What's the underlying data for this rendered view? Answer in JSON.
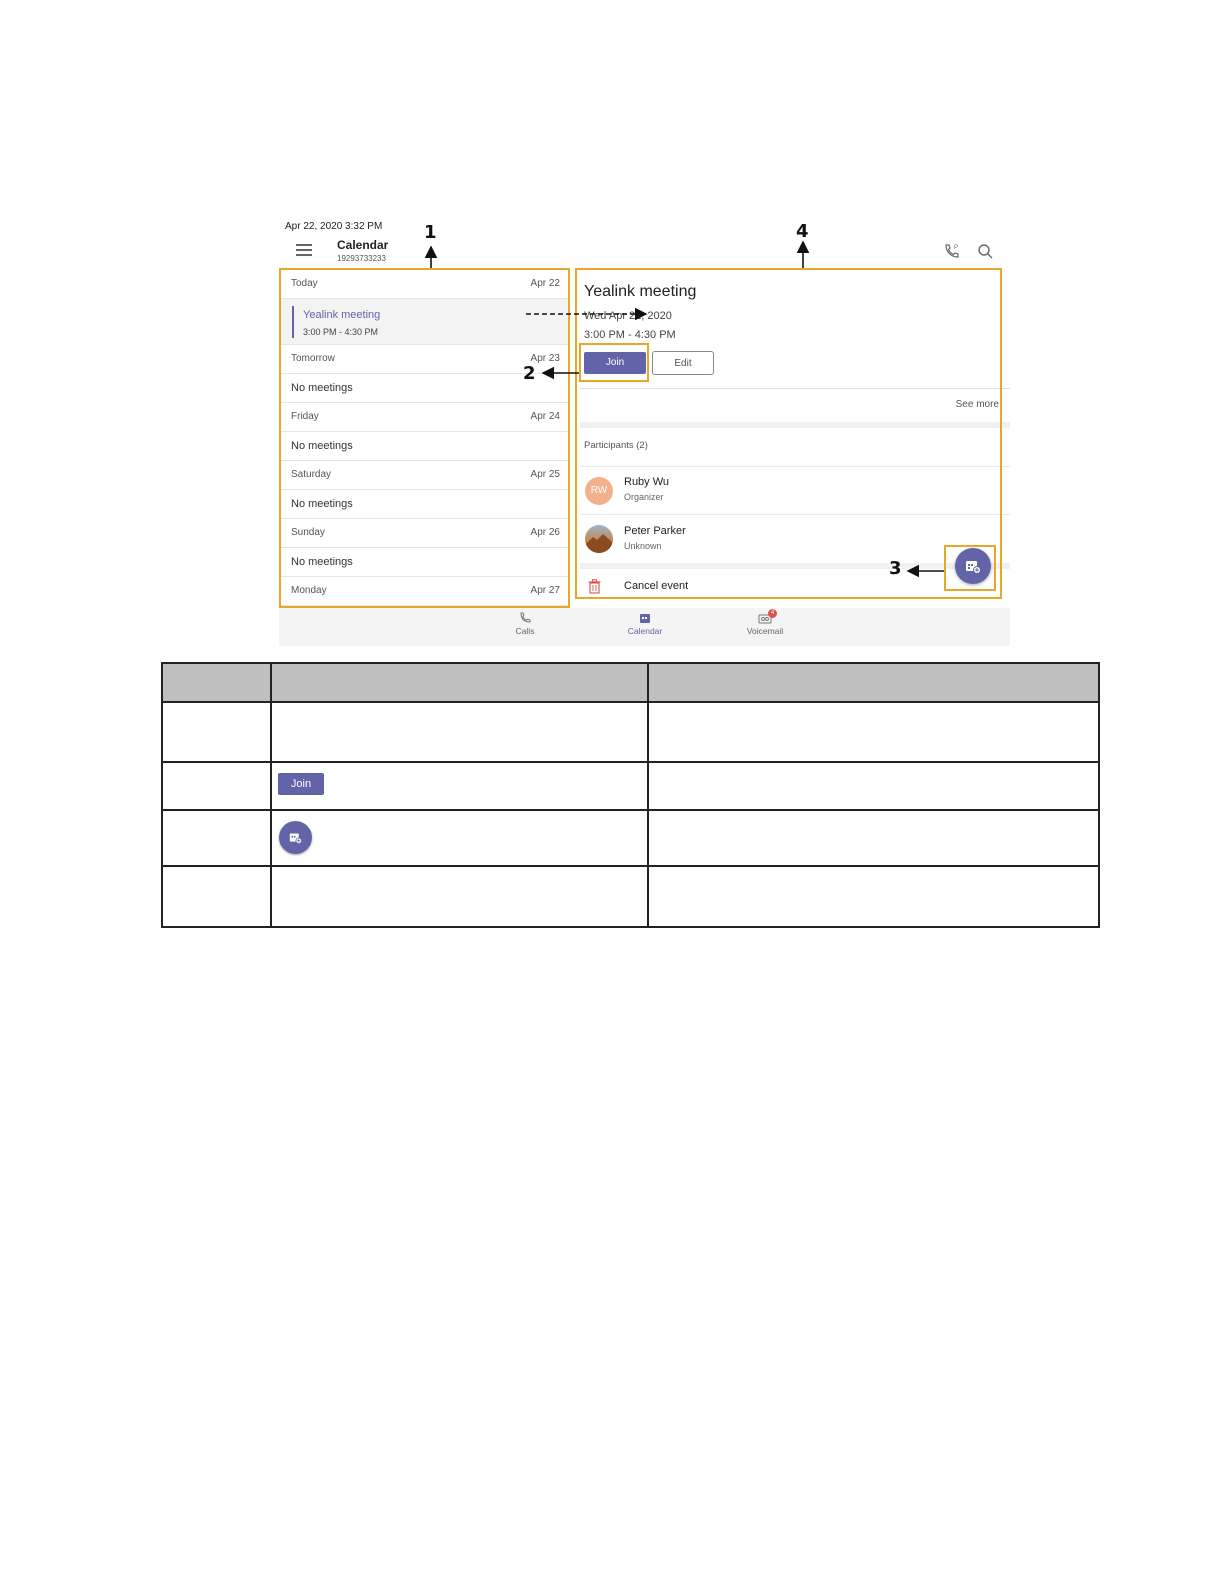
{
  "status_bar": {
    "datetime": "Apr 22, 2020   3:32 PM"
  },
  "header": {
    "title": "Calendar",
    "number": "19293733233"
  },
  "agenda": {
    "days": [
      {
        "name": "Today",
        "date": "Apr 22"
      },
      {
        "name": "Tomorrow",
        "date": "Apr 23"
      },
      {
        "name": "Friday",
        "date": "Apr 24"
      },
      {
        "name": "Saturday",
        "date": "Apr 25"
      },
      {
        "name": "Sunday",
        "date": "Apr 26"
      },
      {
        "name": "Monday",
        "date": "Apr 27"
      }
    ],
    "meeting": {
      "title": "Yealink meeting",
      "time": "3:00 PM - 4:30 PM"
    },
    "no_meetings": "No meetings"
  },
  "details": {
    "title": "Yealink meeting",
    "date": "Wed Apr 22, 2020",
    "time": "3:00 PM - 4:30 PM",
    "join_label": "Join",
    "edit_label": "Edit",
    "see_more": "See more",
    "participants_label": "Participants (2)",
    "participants": [
      {
        "initials": "RW",
        "name": "Ruby Wu",
        "role": "Organizer"
      },
      {
        "initials": "",
        "name": "Peter Parker",
        "role": "Unknown"
      }
    ],
    "cancel_label": "Cancel event"
  },
  "bottom_nav": [
    {
      "label": "Calls",
      "icon": "phone-icon"
    },
    {
      "label": "Calendar",
      "icon": "calendar-icon",
      "active": true
    },
    {
      "label": "Voicemail",
      "icon": "voicemail-icon",
      "badge": "4"
    }
  ],
  "callouts": [
    "1",
    "2",
    "3",
    "4"
  ],
  "table": {
    "join_label": "Join"
  },
  "colors": {
    "accent": "#6264a7",
    "callout": "#e8a825",
    "avatar_rw": "#f3b08d",
    "badge": "#d9534f"
  }
}
